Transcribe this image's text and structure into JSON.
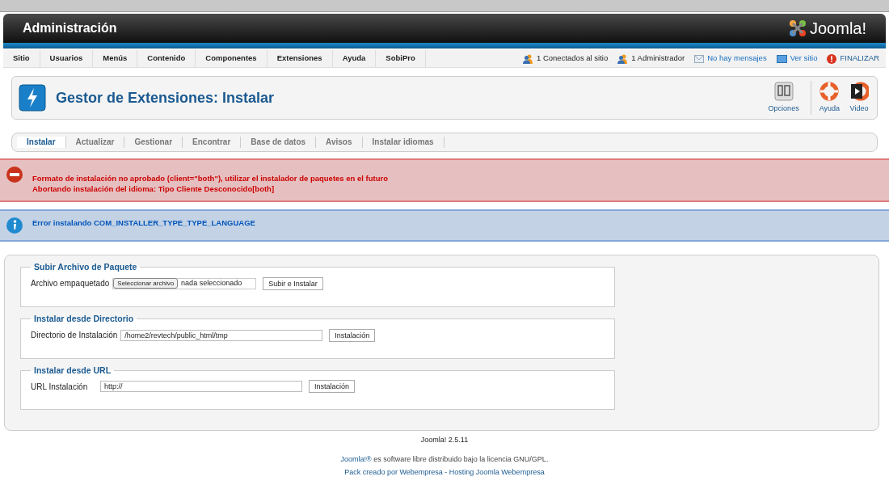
{
  "header": {
    "title": "Administración",
    "logo_text": "Joomla!"
  },
  "menu": [
    {
      "label": "Sitio"
    },
    {
      "label": "Usuarios"
    },
    {
      "label": "Menús"
    },
    {
      "label": "Contenido"
    },
    {
      "label": "Componentes"
    },
    {
      "label": "Extensiones"
    },
    {
      "label": "Ayuda"
    },
    {
      "label": "SobiPro"
    }
  ],
  "status": [
    {
      "kind": "users",
      "text": "1 Conectados al sitio"
    },
    {
      "kind": "admin",
      "text": "1 Administrador"
    },
    {
      "kind": "messages",
      "text": "No hay mensajes"
    },
    {
      "kind": "site",
      "text": "Ver sitio"
    },
    {
      "kind": "logout",
      "text": "FINALIZAR"
    }
  ],
  "toolbar": {
    "title": "Gestor de Extensiones: Instalar",
    "buttons": [
      {
        "kind": "options",
        "label": "Opciones"
      },
      {
        "kind": "help",
        "label": "Ayuda"
      },
      {
        "kind": "video",
        "label": "Video"
      }
    ]
  },
  "subnav": [
    {
      "label": "Instalar",
      "selected": true
    },
    {
      "label": "Actualizar",
      "selected": false
    },
    {
      "label": "Gestionar",
      "selected": false
    },
    {
      "label": "Encontrar",
      "selected": false
    },
    {
      "label": "Base de datos",
      "selected": false
    },
    {
      "label": "Avisos",
      "selected": false
    },
    {
      "label": "Instalar idiomas",
      "selected": false
    }
  ],
  "messages": [
    {
      "kind": "error",
      "lines": [
        "Formato de instalación no aprobado (client=\"both\"), utilizar el instalador de paquetes en el futuro",
        "Abortando instalación del idioma: Tipo Cliente Desconocido[both]"
      ]
    },
    {
      "kind": "info",
      "lines": [
        "Error instalando COM_INSTALLER_TYPE_TYPE_LANGUAGE"
      ]
    }
  ],
  "sections": [
    {
      "kind": "file",
      "legend": "Subir Archivo de Paquete",
      "label": "Archivo empaquetado",
      "file_button": "Seleccionar archivo",
      "value": "nada seleccionado",
      "button": "Subir e Instalar"
    },
    {
      "kind": "text",
      "legend": "Instalar desde Directorio",
      "label": "Directorio de Instalación",
      "value": "/home2/revtech/public_html/tmp",
      "button": "Instalación"
    },
    {
      "kind": "url",
      "legend": "Instalar desde URL",
      "label": "URL Instalación",
      "value": "http://",
      "button": "Instalación"
    }
  ],
  "footer": {
    "version": "Joomla! 2.5.11",
    "license_link": "Joomla!®",
    "license_text": "es software libre distribuido bajo la licencia GNU/GPL.",
    "credit": "Pack creado por Webempresa - Hosting Joomla Webempresa"
  }
}
